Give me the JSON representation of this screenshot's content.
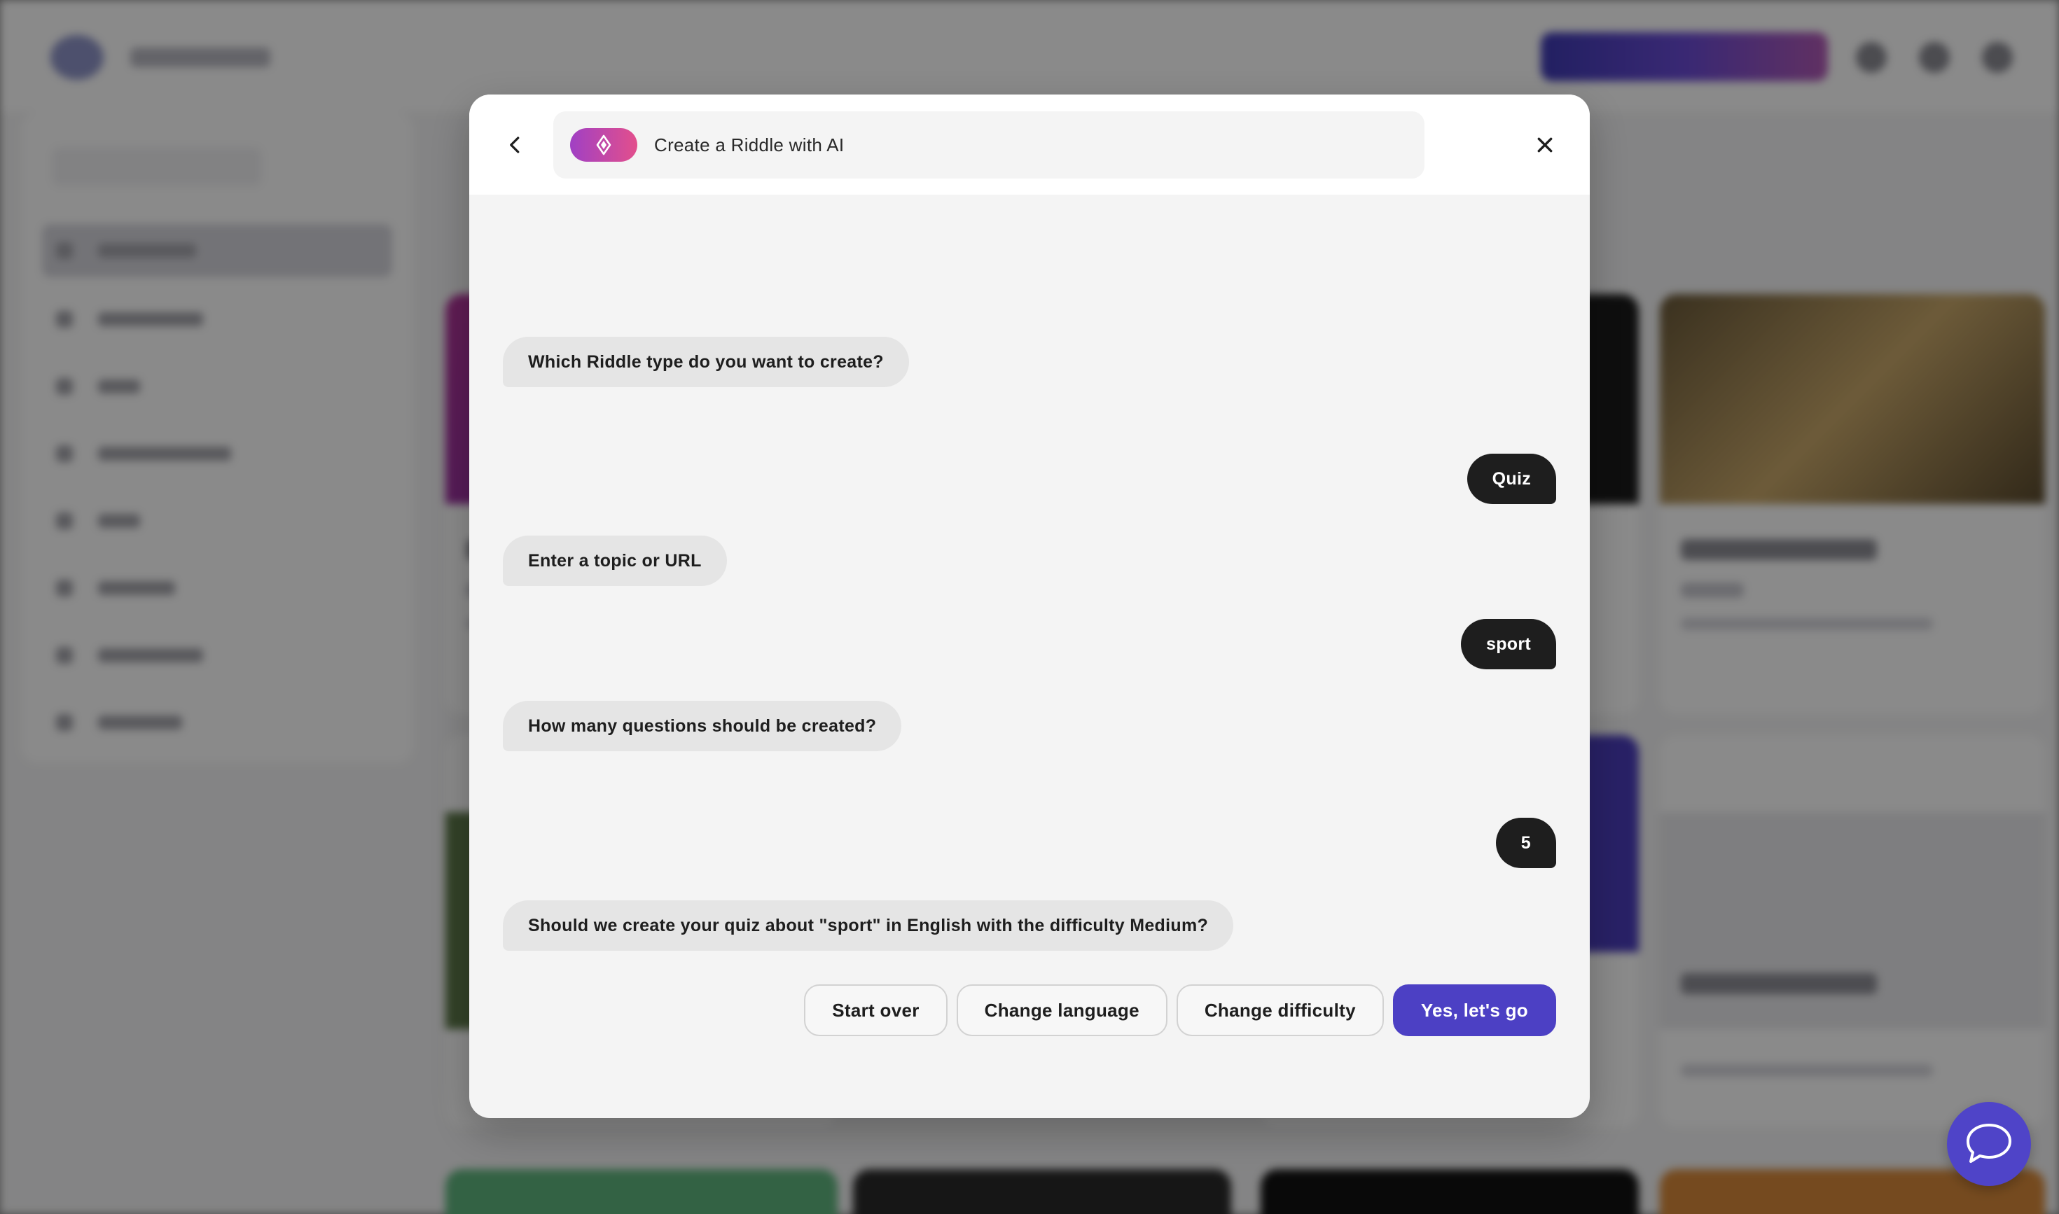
{
  "header": {
    "title": "Create a Riddle with AI",
    "back_icon": "chevron-left-icon",
    "ai_icon": "sparkle-icon",
    "close_icon": "close-icon"
  },
  "conversation": {
    "q1": "Which Riddle type do you want to create?",
    "a1": "Quiz",
    "q2": "Enter a topic or URL",
    "a2": "sport",
    "q3": "How many questions should be created?",
    "a3": "5",
    "q4": "Should we create your quiz about \"sport\" in English with the difficulty Medium?"
  },
  "actions": {
    "start_over": "Start over",
    "change_language": "Change language",
    "change_difficulty": "Change difficulty",
    "confirm": "Yes, let's go"
  },
  "colors": {
    "primary": "#4c40c4",
    "user_bubble": "#1e1e1e",
    "bot_bubble": "#e5e5e5",
    "ai_gradient_start": "#a040c4",
    "ai_gradient_end": "#e34f8c"
  },
  "chat_widget": {
    "icon": "chat-bubble-icon"
  }
}
